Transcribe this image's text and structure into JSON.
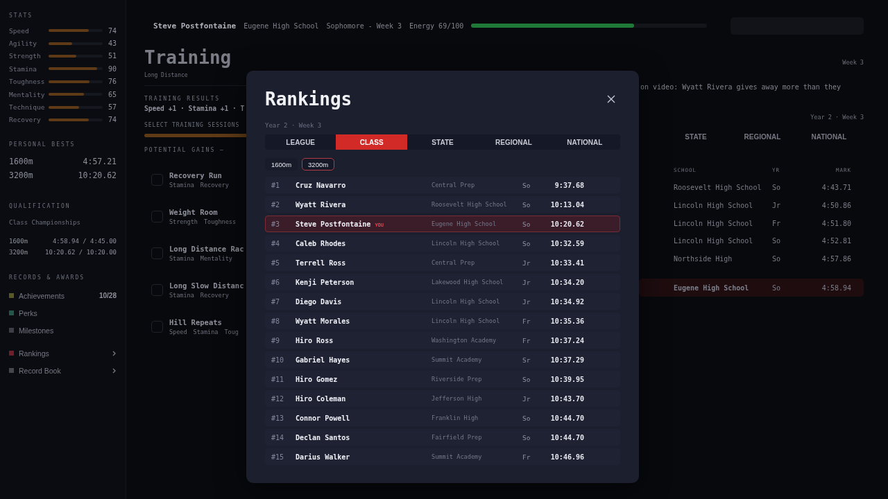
{
  "sidebar": {
    "stats_title": "STATS",
    "stats": [
      {
        "name": "Speed",
        "value": "74",
        "level": 0.74
      },
      {
        "name": "Agility",
        "value": "43",
        "level": 0.43
      },
      {
        "name": "Strength",
        "value": "51",
        "level": 0.51
      },
      {
        "name": "Stamina",
        "value": "90",
        "level": 0.9
      },
      {
        "name": "Toughness",
        "value": "76",
        "level": 0.76
      },
      {
        "name": "Mentality",
        "value": "65",
        "level": 0.65
      },
      {
        "name": "Technique",
        "value": "57",
        "level": 0.57
      },
      {
        "name": "Recovery",
        "value": "74",
        "level": 0.74
      }
    ],
    "bests_title": "PERSONAL BESTS",
    "bests": [
      {
        "event": "1600m",
        "time": "4:57.21"
      },
      {
        "event": "3200m",
        "time": "10:20.62"
      }
    ],
    "qualification_title": "QUALIFICATION",
    "qualification_name": "Class Championships",
    "qualification": [
      {
        "event": "1600m",
        "times": "4:58.94 / 4:45.00"
      },
      {
        "event": "3200m",
        "times": "10:20.62 / 10:20.00"
      }
    ],
    "records_title": "RECORDS & AWARDS",
    "records": [
      {
        "label": "Achievements",
        "color": "#5a5926",
        "count": "10/28",
        "chevron": false
      },
      {
        "label": "Perks",
        "color": "#22574a",
        "chevron": false
      },
      {
        "label": "Milestones",
        "color": "#3d3f46",
        "chevron": false
      },
      {
        "label": "Rankings",
        "color": "#6e1f2a",
        "chevron": true
      },
      {
        "label": "Record Book",
        "color": "#45474e",
        "chevron": true
      }
    ]
  },
  "header": {
    "name": "Steve Postfontaine",
    "school": "Eugene High School",
    "grade": "Sophomore - Week 3",
    "energy": {
      "label": "Energy 69/100",
      "level": 0.69
    }
  },
  "training": {
    "title": "Training",
    "subtitle": "Long Distance",
    "results_title": "TRAINING RESULTS",
    "results": "Speed +1 · Stamina +1 · T",
    "select_title": "SELECT TRAINING SESSIONS",
    "gains_title": "POTENTIAL GAINS —",
    "sessions": [
      {
        "name": "Recovery Run",
        "tags": [
          "Stamina",
          "Recovery"
        ],
        "checked": false
      },
      {
        "name": "Weight Room",
        "tags": [
          "Strength",
          "Toughness"
        ],
        "checked": false
      },
      {
        "name": "Long Distance Rac",
        "tags": [
          "Stamina",
          "Mentality"
        ],
        "checked": false
      },
      {
        "name": "Long Slow Distanc",
        "tags": [
          "Stamina",
          "Recovery"
        ],
        "checked": false
      },
      {
        "name": "Hill Repeats",
        "tags": [
          "Speed",
          "Stamina",
          "Toug"
        ],
        "checked": false
      }
    ]
  },
  "right_panel": {
    "week": "Week 3",
    "news": "on video: Wyatt Rivera gives away more than they",
    "period": "Year 2 · Week 3",
    "tabs": [
      {
        "label": "STATE",
        "selected": false
      },
      {
        "label": "REGIONAL",
        "selected": false
      },
      {
        "label": "NATIONAL",
        "selected": false
      }
    ],
    "columns": [
      "SCHOOL",
      "YR",
      "MARK"
    ],
    "rows": [
      {
        "school": "Roosevelt High School",
        "yr": "So",
        "mark": "4:43.71",
        "highlighted": false
      },
      {
        "school": "Lincoln High School",
        "yr": "Jr",
        "mark": "4:50.86",
        "highlighted": false
      },
      {
        "school": "Lincoln High School",
        "yr": "Fr",
        "mark": "4:51.80",
        "highlighted": false
      },
      {
        "school": "Lincoln High School",
        "yr": "So",
        "mark": "4:52.81",
        "highlighted": false
      },
      {
        "school": "Northside High",
        "yr": "So",
        "mark": "4:57.86",
        "highlighted": false
      },
      {
        "school": "Eugene High School",
        "yr": "So",
        "mark": "4:58.94",
        "highlighted": true
      }
    ]
  },
  "modal": {
    "title": "Rankings",
    "period": "Year 2 · Week 3",
    "tabs": [
      {
        "label": "LEAGUE",
        "selected": false
      },
      {
        "label": "CLASS",
        "selected": true
      },
      {
        "label": "STATE",
        "selected": false
      },
      {
        "label": "REGIONAL",
        "selected": false
      },
      {
        "label": "NATIONAL",
        "selected": false
      }
    ],
    "events": [
      {
        "label": "1600m",
        "selected": false
      },
      {
        "label": "3200m",
        "selected": true
      }
    ],
    "rows": [
      {
        "rank": "#1",
        "name": "Cruz Navarro",
        "school": "Central Prep",
        "yr": "So",
        "time": "9:37.68",
        "highlighted": false
      },
      {
        "rank": "#2",
        "name": "Wyatt Rivera",
        "school": "Roosevelt High School",
        "yr": "So",
        "time": "10:13.04",
        "highlighted": false
      },
      {
        "rank": "#3",
        "name": "Steve Postfontaine",
        "badge": "YOU",
        "school": "Eugene High School",
        "yr": "So",
        "time": "10:20.62",
        "highlighted": true
      },
      {
        "rank": "#4",
        "name": "Caleb Rhodes",
        "school": "Lincoln High School",
        "yr": "So",
        "time": "10:32.59",
        "highlighted": false
      },
      {
        "rank": "#5",
        "name": "Terrell Ross",
        "school": "Central Prep",
        "yr": "Jr",
        "time": "10:33.41",
        "highlighted": false
      },
      {
        "rank": "#6",
        "name": "Kenji Peterson",
        "school": "Lakewood High School",
        "yr": "Jr",
        "time": "10:34.20",
        "highlighted": false
      },
      {
        "rank": "#7",
        "name": "Diego Davis",
        "school": "Lincoln High School",
        "yr": "Jr",
        "time": "10:34.92",
        "highlighted": false
      },
      {
        "rank": "#8",
        "name": "Wyatt Morales",
        "school": "Lincoln High School",
        "yr": "Fr",
        "time": "10:35.36",
        "highlighted": false
      },
      {
        "rank": "#9",
        "name": "Hiro Ross",
        "school": "Washington Academy",
        "yr": "Fr",
        "time": "10:37.24",
        "highlighted": false
      },
      {
        "rank": "#10",
        "name": "Gabriel Hayes",
        "school": "Summit Academy",
        "yr": "Sr",
        "time": "10:37.29",
        "highlighted": false
      },
      {
        "rank": "#11",
        "name": "Hiro Gomez",
        "school": "Riverside Prep",
        "yr": "So",
        "time": "10:39.95",
        "highlighted": false
      },
      {
        "rank": "#12",
        "name": "Hiro Coleman",
        "school": "Jefferson High",
        "yr": "Jr",
        "time": "10:43.70",
        "highlighted": false
      },
      {
        "rank": "#13",
        "name": "Connor Powell",
        "school": "Franklin High",
        "yr": "So",
        "time": "10:44.70",
        "highlighted": false
      },
      {
        "rank": "#14",
        "name": "Declan Santos",
        "school": "Fairfield Prep",
        "yr": "So",
        "time": "10:44.70",
        "highlighted": false
      },
      {
        "rank": "#15",
        "name": "Darius Walker",
        "school": "Summit Academy",
        "yr": "Fr",
        "time": "10:46.96",
        "highlighted": false
      }
    ]
  }
}
